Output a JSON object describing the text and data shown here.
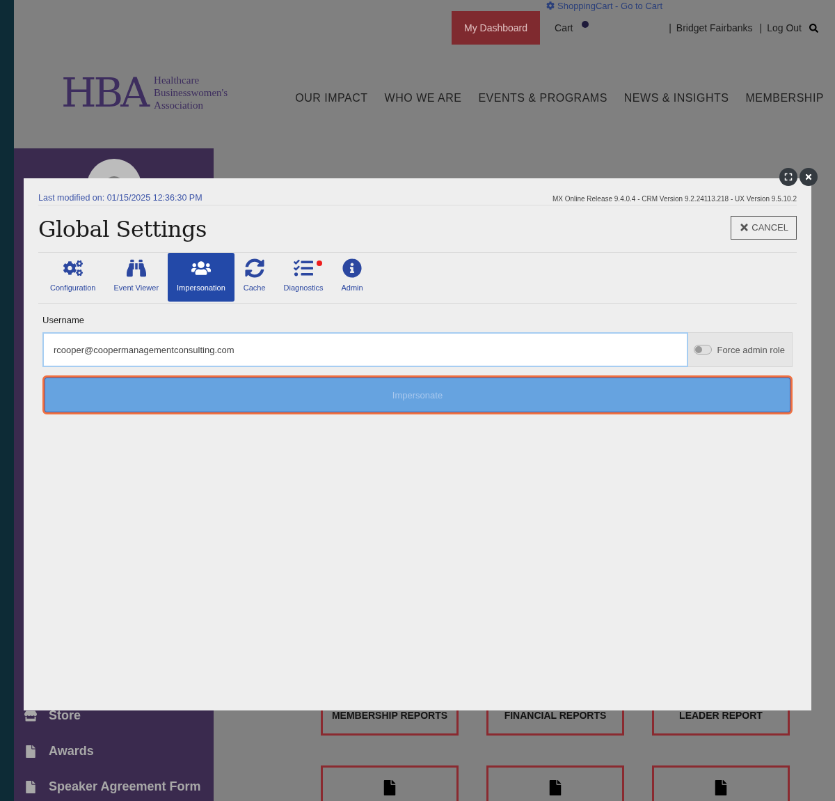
{
  "header": {
    "cart_link": "ShoppingCart - Go to Cart",
    "dashboard_button": "My Dashboard",
    "cart": "Cart",
    "separator": "|",
    "user_links": [
      "Bridget Fairbanks",
      "Log Out"
    ],
    "logo": {
      "mark": "HBA",
      "lines": [
        "Healthcare",
        "Businesswomen's",
        "Association"
      ]
    },
    "nav": [
      "OUR IMPACT",
      "WHO WE ARE",
      "EVENTS & PROGRAMS",
      "NEWS & INSIGHTS",
      "MEMBERSHIP"
    ]
  },
  "sidebar": {
    "items": [
      {
        "kind": "store",
        "label": "Store"
      },
      {
        "kind": "file",
        "label": "Awards"
      },
      {
        "kind": "file",
        "label": "Speaker Agreement Form"
      }
    ]
  },
  "report_cards": [
    {
      "kind": "title",
      "title": "MEMBERSHIP REPORTS"
    },
    {
      "kind": "title",
      "title": "FINANCIAL REPORTS"
    },
    {
      "kind": "title",
      "title": "LEADER REPORT"
    },
    {
      "kind": "icon"
    },
    {
      "kind": "icon"
    },
    {
      "kind": "icon"
    }
  ],
  "modal": {
    "last_modified": "Last modified on: 01/15/2025 12:36:30 PM",
    "version": "MX Online Release 9.4.0.4 - CRM Version 9.2.24113.218 - UX Version 9.5.10.2",
    "title": "Global Settings",
    "cancel_button": "CANCEL",
    "tabs": [
      {
        "label": "Configuration",
        "selected": false,
        "badge": false
      },
      {
        "label": "Event Viewer",
        "selected": false,
        "badge": false
      },
      {
        "label": "Impersonation",
        "selected": true,
        "badge": false
      },
      {
        "label": "Cache",
        "selected": false,
        "badge": false
      },
      {
        "label": "Diagnostics",
        "selected": false,
        "badge": true
      },
      {
        "label": "Admin",
        "selected": false,
        "badge": false
      }
    ],
    "username_label": "Username",
    "username_value": "rcooper@coopermanagementconsulting.com",
    "force_admin": {
      "label": "Force admin role",
      "on": false
    },
    "impersonate_button": {
      "label": "Impersonate",
      "disabled": true
    }
  }
}
